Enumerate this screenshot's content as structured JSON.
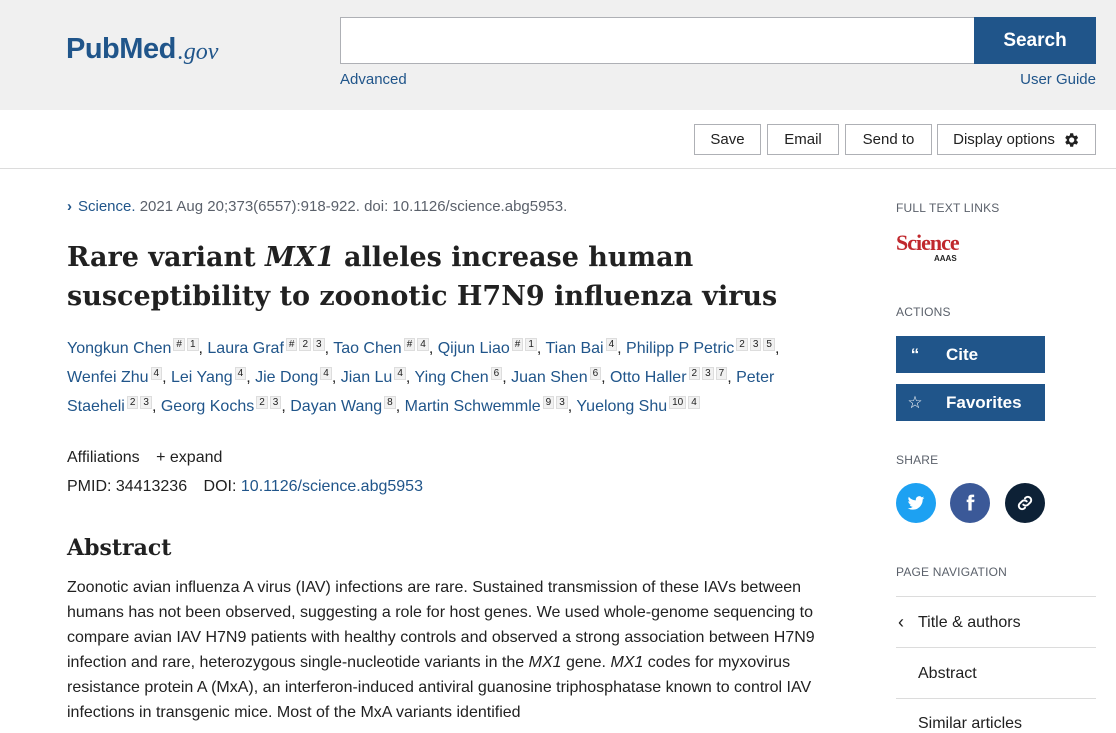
{
  "header": {
    "logo_pub": "Pub",
    "logo_med": "Med",
    "logo_gov": ".gov",
    "search_placeholder": "",
    "search_button": "Search",
    "advanced": "Advanced",
    "user_guide": "User Guide"
  },
  "toolbar": {
    "save": "Save",
    "email": "Email",
    "send_to": "Send to",
    "display_options": "Display options"
  },
  "article": {
    "journal": "Science.",
    "citation": " 2021 Aug 20;373(6557):918-922. doi: 10.1126/science.abg5953.",
    "title_pre": "Rare variant ",
    "title_gene": "MX1",
    "title_post": " alleles increase human susceptibility to zoonotic H7N9 influenza virus",
    "authors": [
      {
        "name": "Yongkun Chen",
        "sup": [
          "#",
          "1"
        ]
      },
      {
        "name": "Laura Graf",
        "sup": [
          "#",
          "2",
          "3"
        ]
      },
      {
        "name": "Tao Chen",
        "sup": [
          "#",
          "4"
        ]
      },
      {
        "name": "Qijun Liao",
        "sup": [
          "#",
          "1"
        ]
      },
      {
        "name": "Tian Bai",
        "sup": [
          "4"
        ]
      },
      {
        "name": "Philipp P Petric",
        "sup": [
          "2",
          "3",
          "5"
        ]
      },
      {
        "name": "Wenfei Zhu",
        "sup": [
          "4"
        ]
      },
      {
        "name": "Lei Yang",
        "sup": [
          "4"
        ]
      },
      {
        "name": "Jie Dong",
        "sup": [
          "4"
        ]
      },
      {
        "name": "Jian Lu",
        "sup": [
          "4"
        ]
      },
      {
        "name": "Ying Chen",
        "sup": [
          "6"
        ]
      },
      {
        "name": "Juan Shen",
        "sup": [
          "6"
        ]
      },
      {
        "name": "Otto Haller",
        "sup": [
          "2",
          "3",
          "7"
        ]
      },
      {
        "name": "Peter Staeheli",
        "sup": [
          "2",
          "3"
        ]
      },
      {
        "name": "Georg Kochs",
        "sup": [
          "2",
          "3"
        ]
      },
      {
        "name": "Dayan Wang",
        "sup": [
          "8"
        ]
      },
      {
        "name": "Martin Schwemmle",
        "sup": [
          "9",
          "3"
        ]
      },
      {
        "name": "Yuelong Shu",
        "sup": [
          "10",
          "4"
        ]
      }
    ],
    "affiliations": "Affiliations",
    "expand": "expand",
    "pmid_label": "PMID:",
    "pmid": "34413236",
    "doi_label": "DOI:",
    "doi": "10.1126/science.abg5953",
    "abstract_heading": "Abstract",
    "abstract_parts": [
      {
        "t": "Zoonotic avian influenza A virus (IAV) infections are rare. Sustained transmission of these IAVs between humans has not been observed, suggesting a role for host genes. We used whole-genome sequencing to compare avian IAV H7N9 patients with healthy controls and observed a strong association between H7N9 infection and rare, heterozygous single-nucleotide variants in the ",
        "i": false
      },
      {
        "t": "MX1",
        "i": true
      },
      {
        "t": " gene. ",
        "i": false
      },
      {
        "t": "MX1",
        "i": true
      },
      {
        "t": " codes for myxovirus resistance protein A (MxA), an interferon-induced antiviral guanosine triphosphatase known to control IAV infections in transgenic mice. Most of the MxA variants identified",
        "i": false
      }
    ]
  },
  "sidebar": {
    "full_text_links": "FULL TEXT LINKS",
    "science_logo": "Science",
    "science_sub": "AAAS",
    "actions": "ACTIONS",
    "cite": "Cite",
    "favorites": "Favorites",
    "share": "SHARE",
    "page_navigation": "PAGE NAVIGATION",
    "nav_items": [
      "Title & authors",
      "Abstract",
      "Similar articles"
    ]
  },
  "colors": {
    "brand": "#20558a",
    "twitter": "#1da1f2",
    "facebook": "#3b5998",
    "link_share": "#0d2136"
  }
}
